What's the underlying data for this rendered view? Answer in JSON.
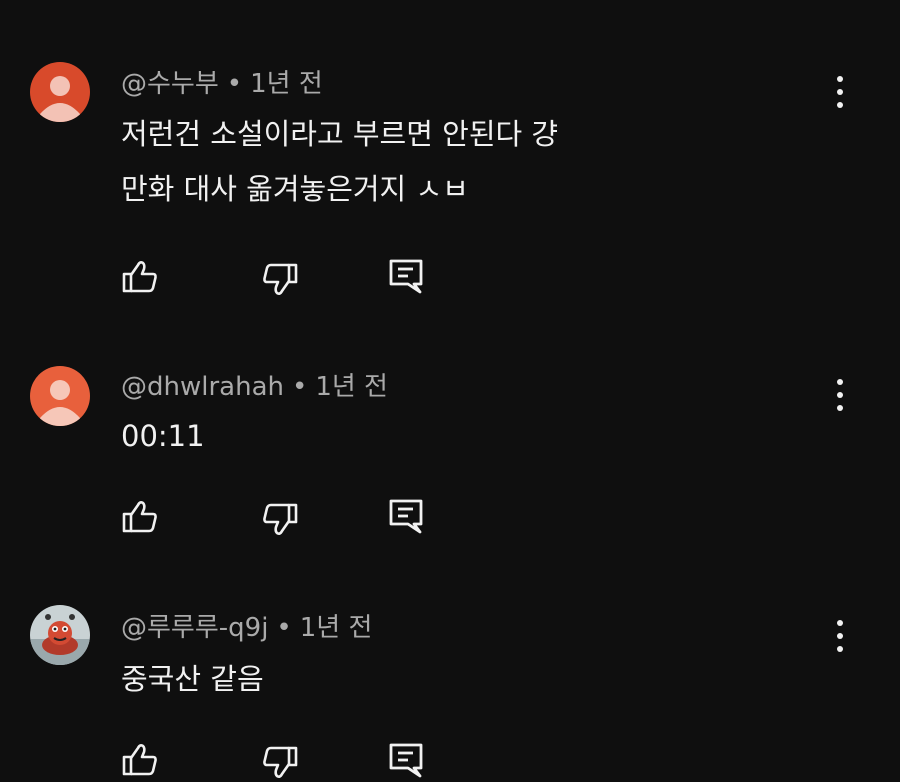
{
  "comments": [
    {
      "author": "@수누부",
      "separator": "•",
      "time": "1년 전",
      "lines": [
        "저런건 소설이라고 부르면 안된다 걍",
        "만화 대사 옮겨놓은거지 ㅅㅂ"
      ],
      "avatar_color": "#d84a2b"
    },
    {
      "author": "@dhwlrahah",
      "separator": "•",
      "time": "1년 전",
      "lines": [
        "00:11"
      ],
      "avatar_color": "#e8603c"
    },
    {
      "author": "@루루루-q9j",
      "separator": "•",
      "time": "1년 전",
      "lines": [
        "중국산 같음"
      ],
      "avatar_color": "#b8c4c8"
    }
  ],
  "icons": {
    "like": "thumbs-up-icon",
    "dislike": "thumbs-down-icon",
    "reply": "reply-icon",
    "more": "more-vertical-icon"
  },
  "colors": {
    "background": "#0f0f0f",
    "text": "#f1f1f1",
    "meta_text": "#aaaaaa"
  }
}
